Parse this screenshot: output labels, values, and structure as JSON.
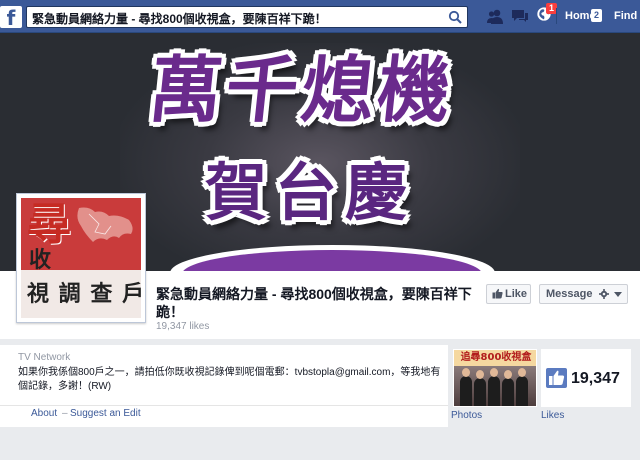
{
  "topbar": {
    "logo_letter": "f",
    "search_value": "緊急動員網絡力量 - 尋找800個收視盒，要陳百祥下跪！",
    "notification_count": "1",
    "home_label": "Home",
    "home_count": "2",
    "find_label": "Find",
    "brand_color": "#3b5998"
  },
  "cover": {
    "line1": "萬千熄機",
    "line2": "賀台慶"
  },
  "profile_pic": {
    "big_char": "尋",
    "line1": "收",
    "line2": "視 調 查 戶"
  },
  "page": {
    "title": "緊急動員網絡力量 - 尋找800個收視盒，要陳百祥下跪！",
    "likes_text": "19,347 likes",
    "like_button": "Like",
    "message_button": "Message"
  },
  "info": {
    "category": "TV Network",
    "description": "如果你我係個800戶之一，請拍低你既收視記錄俾到呢個電郵：tvbstopla@gmail.com，等我地有個記錄，多謝！(RW)",
    "about_link": "About",
    "separator": "–",
    "suggest_link": "Suggest an Edit"
  },
  "photos": {
    "banner": "追尋800收視盒",
    "label": "Photos"
  },
  "likes": {
    "count": "19,347",
    "label": "Likes"
  }
}
